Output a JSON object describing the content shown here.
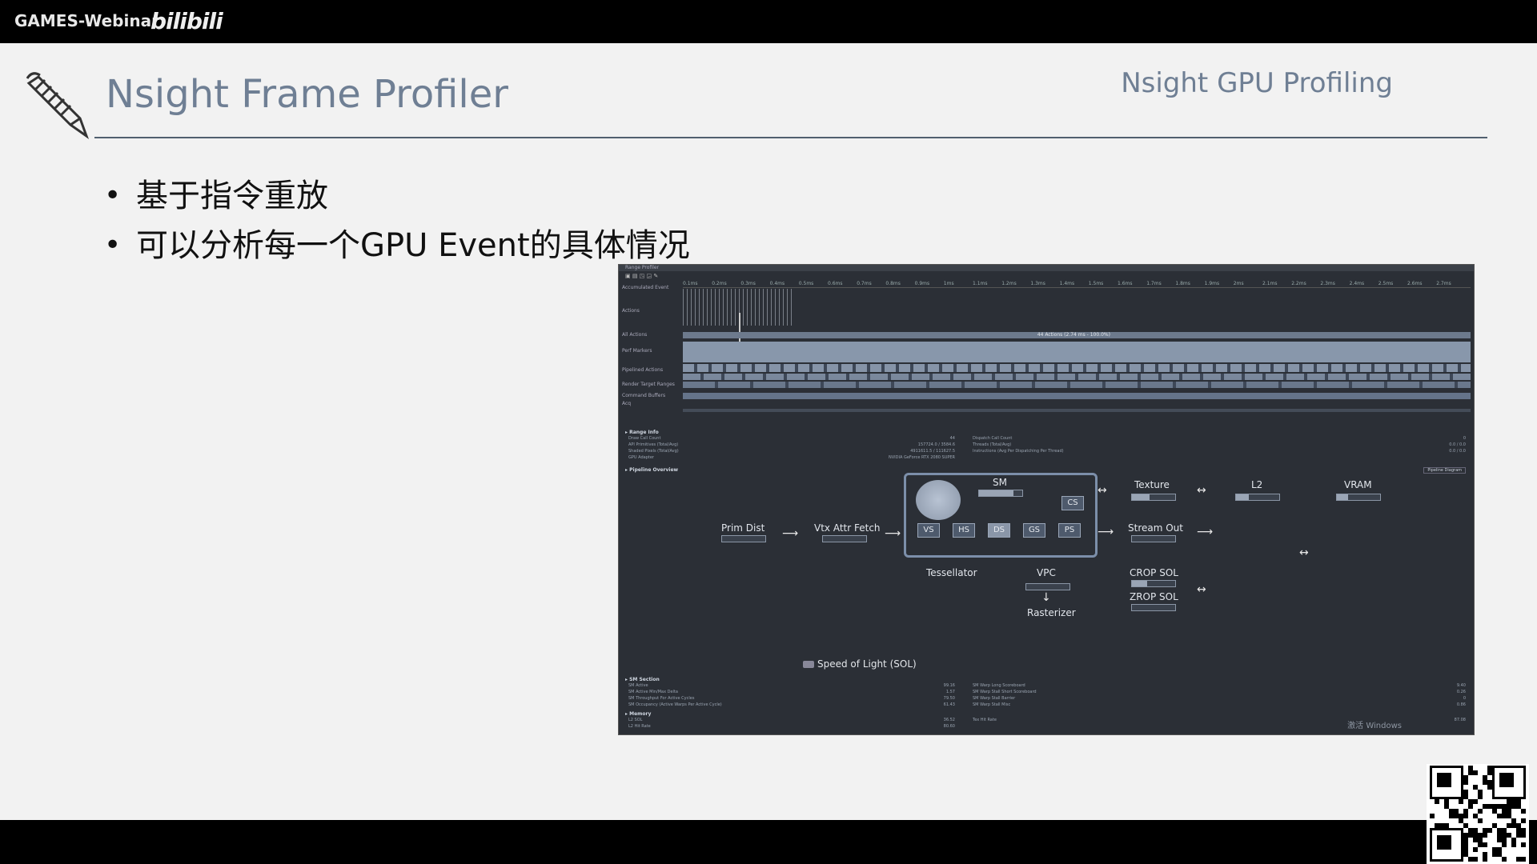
{
  "header": {
    "brand": "GAMES-Webinar",
    "logo_text": "bilibili"
  },
  "slide": {
    "title": "Nsight Frame Profiler",
    "subtitle": "Nsight GPU Profiling",
    "bullets": [
      "基于指令重放",
      "可以分析每一个GPU Event的具体情况"
    ]
  },
  "profiler": {
    "window_title": "Range Profiler",
    "ticks": [
      "0.1ms",
      "0.2ms",
      "0.3ms",
      "0.4ms",
      "0.5ms",
      "0.6ms",
      "0.7ms",
      "0.8ms",
      "0.9ms",
      "1ms",
      "1.1ms",
      "1.2ms",
      "1.3ms",
      "1.4ms",
      "1.5ms",
      "1.6ms",
      "1.7ms",
      "1.8ms",
      "1.9ms",
      "2ms",
      "2.1ms",
      "2.2ms",
      "2.3ms",
      "2.4ms",
      "2.5ms",
      "2.6ms",
      "2.7ms"
    ],
    "rows": [
      "Accumulated Event",
      "Actions",
      "All Actions",
      "Perf Markers",
      "Pipelined Actions",
      "Render Target Ranges",
      "Command Buffers",
      "Acq"
    ],
    "all_actions_text": "44 Actions (2.74 ms - 100.0%)",
    "range_info_title": "Range Info",
    "range_info": [
      {
        "k": "Draw Call Count",
        "v": "44",
        "k2": "Dispatch Call Count",
        "v2": "0"
      },
      {
        "k": "API Primitives (Total/Avg)",
        "v": "157724.0 / 3584.6",
        "k2": "Threads (Total/Avg)",
        "v2": "0.0 / 0.0"
      },
      {
        "k": "Shaded Pixels (Total/Avg)",
        "v": "4911611.5 / 111627.5",
        "k2": "Instructions (Avg Per Dispatching Per Thread)",
        "v2": "0.0 / 0.0"
      },
      {
        "k": "GPU Adapter",
        "v": "NVIDIA GeForce RTX 2080 SUPER",
        "k2": "",
        "v2": ""
      }
    ],
    "pipeline_title": "Pipeline Overview",
    "pipeline_mode": "Pipeline Diagram",
    "pipeline": {
      "sm": "SM",
      "cs": "CS",
      "stages": [
        "VS",
        "HS",
        "DS",
        "GS",
        "PS"
      ],
      "prim_dist": "Prim Dist",
      "vtx_attr_fetch": "Vtx Attr Fetch",
      "tessellator": "Tessellator",
      "vpc": "VPC",
      "rasterizer": "Rasterizer",
      "texture": "Texture",
      "l2": "L2",
      "vram": "VRAM",
      "stream_out": "Stream Out",
      "crop_sol": "CROP SOL",
      "zrop_sol": "ZROP SOL"
    },
    "sol_label": "Speed of Light (SOL)",
    "sm_section_title": "SM Section",
    "sm_section": [
      {
        "k": "SM Active",
        "v": "99.16",
        "k2": "SM Warp Long Scoreboard",
        "v2": "9.40"
      },
      {
        "k": "SM Active Min/Max Delta",
        "v": "1.57",
        "k2": "SM Warp Stall Short Scoreboard",
        "v2": "0.26"
      },
      {
        "k": "SM Throughput For Active Cycles",
        "v": "79.50",
        "k2": "SM Warp Stall Barrier",
        "v2": "0"
      },
      {
        "k": "SM Occupancy (Active Warps Per Active Cycle)",
        "v": "61.43",
        "k2": "SM Warp Stall Misc",
        "v2": "0.86"
      }
    ],
    "memory_title": "Memory",
    "memory": [
      {
        "k": "L2 SOL",
        "v": "36.52",
        "k2": "Tex Hit Rate",
        "v2": "87.08"
      },
      {
        "k": "L2 Hit Rate",
        "v": "80.60",
        "k2": "",
        "v2": ""
      }
    ],
    "watermark": "激活 Windows"
  },
  "colors": {
    "title": "#6f7f94",
    "panel_bg": "#2b2f36",
    "accent": "#7c8faa"
  }
}
